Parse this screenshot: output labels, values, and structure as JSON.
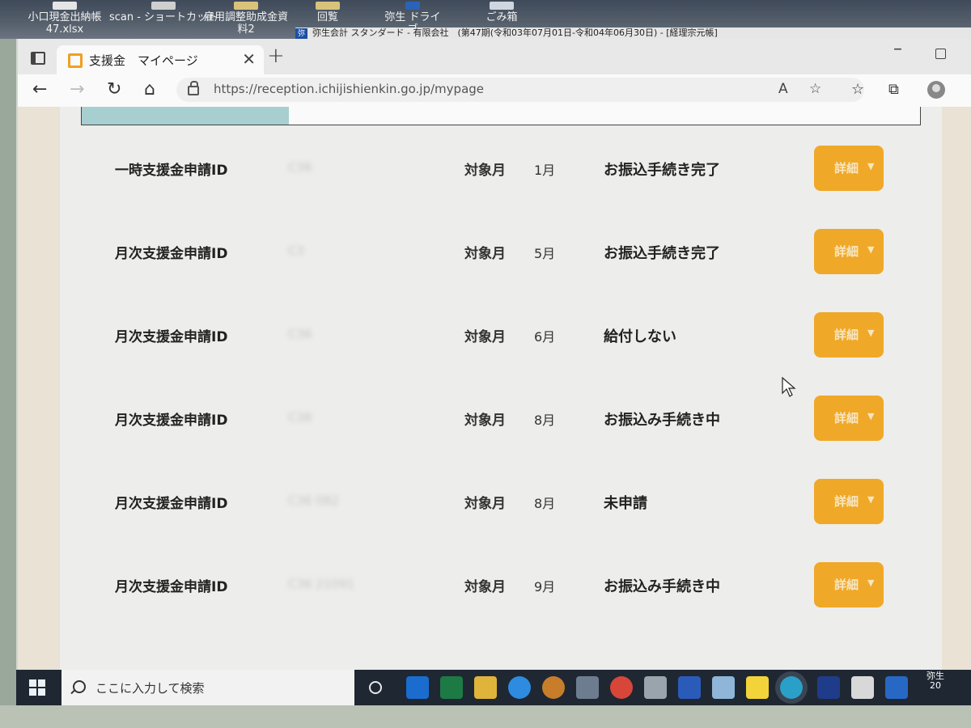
{
  "desktop": {
    "icons": [
      {
        "label": "小口現金出納帳\n47.xlsx"
      },
      {
        "label": "scan - ショートカット"
      },
      {
        "label": "雇用調整助成金資\n料2"
      },
      {
        "label": "回覧"
      },
      {
        "label": "弥生 ドライブ"
      },
      {
        "label": "ごみ箱"
      }
    ],
    "background_window_title": "弥生会計 スタンダード - 有限会社　(第47期(令和03年07月01日-令和04年06月30日) - [経理宗元帳]"
  },
  "browser": {
    "tab_title": "支援金　マイページ",
    "url": "https://reception.ichijishienkin.go.jp/mypage",
    "favicon_color": "#f0a020"
  },
  "rows": [
    {
      "label": "一時支援金申請ID",
      "id": "C36",
      "month_label": "対象月",
      "month": "1月",
      "status": "お振込手続き完了",
      "button": "詳細"
    },
    {
      "label": "月次支援金申請ID",
      "id": "C3",
      "month_label": "対象月",
      "month": "5月",
      "status": "お振込手続き完了",
      "button": "詳細"
    },
    {
      "label": "月次支援金申請ID",
      "id": "C36",
      "month_label": "対象月",
      "month": "6月",
      "status": "給付しない",
      "button": "詳細"
    },
    {
      "label": "月次支援金申請ID",
      "id": "C36",
      "month_label": "対象月",
      "month": "8月",
      "status": "お振込み手続き中",
      "button": "詳細"
    },
    {
      "label": "月次支援金申請ID",
      "id": "C36 082",
      "month_label": "対象月",
      "month": "8月",
      "status": "未申請",
      "button": "詳細"
    },
    {
      "label": "月次支援金申請ID",
      "id": "C36 21091",
      "month_label": "対象月",
      "month": "9月",
      "status": "お振込み手続き中",
      "button": "詳細"
    }
  ],
  "taskbar": {
    "search_placeholder": "ここに入力して検索",
    "yayoi_label": "弥生\n20"
  },
  "colors": {
    "detail_button": "#f0a828",
    "teal_tab": "#a7cfcf"
  }
}
